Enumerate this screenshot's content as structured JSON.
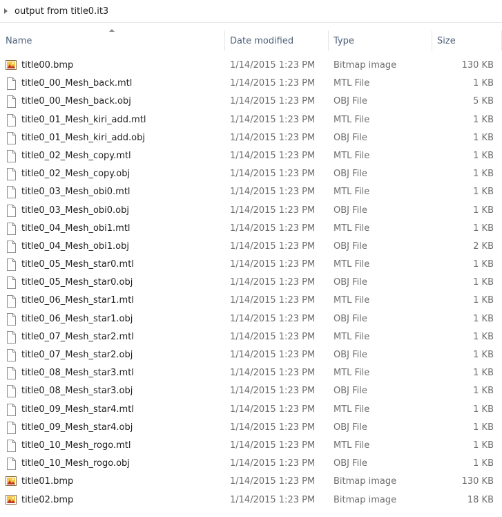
{
  "breadcrumb": {
    "label": "output from title0.it3"
  },
  "columns": {
    "name": "Name",
    "date": "Date modified",
    "type": "Type",
    "size": "Size"
  },
  "files": [
    {
      "name": "title00.bmp",
      "date": "1/14/2015 1:23 PM",
      "type": "Bitmap image",
      "size": "130 KB",
      "icon": "bitmap-icon"
    },
    {
      "name": "title0_00_Mesh_back.mtl",
      "date": "1/14/2015 1:23 PM",
      "type": "MTL File",
      "size": "1 KB",
      "icon": "file-icon"
    },
    {
      "name": "title0_00_Mesh_back.obj",
      "date": "1/14/2015 1:23 PM",
      "type": "OBJ File",
      "size": "5 KB",
      "icon": "file-icon"
    },
    {
      "name": "title0_01_Mesh_kiri_add.mtl",
      "date": "1/14/2015 1:23 PM",
      "type": "MTL File",
      "size": "1 KB",
      "icon": "file-icon"
    },
    {
      "name": "title0_01_Mesh_kiri_add.obj",
      "date": "1/14/2015 1:23 PM",
      "type": "OBJ File",
      "size": "1 KB",
      "icon": "file-icon"
    },
    {
      "name": "title0_02_Mesh_copy.mtl",
      "date": "1/14/2015 1:23 PM",
      "type": "MTL File",
      "size": "1 KB",
      "icon": "file-icon"
    },
    {
      "name": "title0_02_Mesh_copy.obj",
      "date": "1/14/2015 1:23 PM",
      "type": "OBJ File",
      "size": "1 KB",
      "icon": "file-icon"
    },
    {
      "name": "title0_03_Mesh_obi0.mtl",
      "date": "1/14/2015 1:23 PM",
      "type": "MTL File",
      "size": "1 KB",
      "icon": "file-icon"
    },
    {
      "name": "title0_03_Mesh_obi0.obj",
      "date": "1/14/2015 1:23 PM",
      "type": "OBJ File",
      "size": "1 KB",
      "icon": "file-icon"
    },
    {
      "name": "title0_04_Mesh_obi1.mtl",
      "date": "1/14/2015 1:23 PM",
      "type": "MTL File",
      "size": "1 KB",
      "icon": "file-icon"
    },
    {
      "name": "title0_04_Mesh_obi1.obj",
      "date": "1/14/2015 1:23 PM",
      "type": "OBJ File",
      "size": "2 KB",
      "icon": "file-icon"
    },
    {
      "name": "title0_05_Mesh_star0.mtl",
      "date": "1/14/2015 1:23 PM",
      "type": "MTL File",
      "size": "1 KB",
      "icon": "file-icon"
    },
    {
      "name": "title0_05_Mesh_star0.obj",
      "date": "1/14/2015 1:23 PM",
      "type": "OBJ File",
      "size": "1 KB",
      "icon": "file-icon"
    },
    {
      "name": "title0_06_Mesh_star1.mtl",
      "date": "1/14/2015 1:23 PM",
      "type": "MTL File",
      "size": "1 KB",
      "icon": "file-icon"
    },
    {
      "name": "title0_06_Mesh_star1.obj",
      "date": "1/14/2015 1:23 PM",
      "type": "OBJ File",
      "size": "1 KB",
      "icon": "file-icon"
    },
    {
      "name": "title0_07_Mesh_star2.mtl",
      "date": "1/14/2015 1:23 PM",
      "type": "MTL File",
      "size": "1 KB",
      "icon": "file-icon"
    },
    {
      "name": "title0_07_Mesh_star2.obj",
      "date": "1/14/2015 1:23 PM",
      "type": "OBJ File",
      "size": "1 KB",
      "icon": "file-icon"
    },
    {
      "name": "title0_08_Mesh_star3.mtl",
      "date": "1/14/2015 1:23 PM",
      "type": "MTL File",
      "size": "1 KB",
      "icon": "file-icon"
    },
    {
      "name": "title0_08_Mesh_star3.obj",
      "date": "1/14/2015 1:23 PM",
      "type": "OBJ File",
      "size": "1 KB",
      "icon": "file-icon"
    },
    {
      "name": "title0_09_Mesh_star4.mtl",
      "date": "1/14/2015 1:23 PM",
      "type": "MTL File",
      "size": "1 KB",
      "icon": "file-icon"
    },
    {
      "name": "title0_09_Mesh_star4.obj",
      "date": "1/14/2015 1:23 PM",
      "type": "OBJ File",
      "size": "1 KB",
      "icon": "file-icon"
    },
    {
      "name": "title0_10_Mesh_rogo.mtl",
      "date": "1/14/2015 1:23 PM",
      "type": "MTL File",
      "size": "1 KB",
      "icon": "file-icon"
    },
    {
      "name": "title0_10_Mesh_rogo.obj",
      "date": "1/14/2015 1:23 PM",
      "type": "OBJ File",
      "size": "1 KB",
      "icon": "file-icon"
    },
    {
      "name": "title01.bmp",
      "date": "1/14/2015 1:23 PM",
      "type": "Bitmap image",
      "size": "130 KB",
      "icon": "bitmap-icon"
    },
    {
      "name": "title02.bmp",
      "date": "1/14/2015 1:23 PM",
      "type": "Bitmap image",
      "size": "18 KB",
      "icon": "bitmap-icon"
    }
  ],
  "colors": {
    "header_text": "#4c607a",
    "secondary_text": "#6d6d6d",
    "primary_text": "#1e1e1e"
  }
}
